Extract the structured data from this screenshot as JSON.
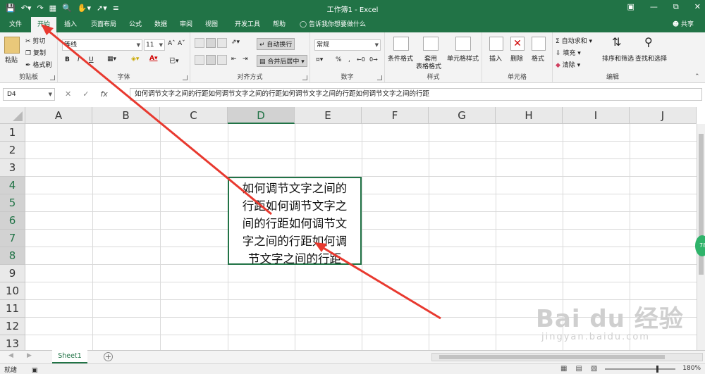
{
  "window": {
    "title": "工作簿1  -  Excel"
  },
  "tabs": [
    {
      "label": "文件"
    },
    {
      "label": "开始"
    },
    {
      "label": "插入"
    },
    {
      "label": "页面布局"
    },
    {
      "label": "公式"
    },
    {
      "label": "数据"
    },
    {
      "label": "审阅"
    },
    {
      "label": "视图"
    },
    {
      "label": "开发工具"
    },
    {
      "label": "帮助"
    }
  ],
  "tell_me": "告诉我你想要做什么",
  "share": "共享",
  "ribbon": {
    "clipboard": {
      "label": "剪贴板",
      "paste": "粘贴",
      "cut": "剪切",
      "copy": "复制",
      "format_painter": "格式刷"
    },
    "font": {
      "label": "字体",
      "font_name": "等线",
      "font_size": "11",
      "bold": "B",
      "italic": "I",
      "underline": "U"
    },
    "alignment": {
      "label": "对齐方式",
      "wrap": "自动换行",
      "merge": "合并后居中"
    },
    "number": {
      "label": "数字",
      "format": "常规",
      "percent": "%",
      "comma": ","
    },
    "styles": {
      "label": "样式",
      "conditional": "条件格式",
      "table1": "套用",
      "table2": "表格格式",
      "cell_styles": "单元格样式"
    },
    "cells": {
      "label": "单元格",
      "insert": "插入",
      "delete": "删除",
      "format": "格式"
    },
    "editing": {
      "label": "编辑",
      "autosum": "自动求和",
      "fill": "填充",
      "clear": "清除",
      "sort": "排序和筛选",
      "find": "查找和选择"
    }
  },
  "formula_bar": {
    "name_box": "D4",
    "fx": "fx",
    "content": "如何调节文字之间的行距如何调节文字之间的行距如何调节文字之间的行距如何调节文字之间的行距"
  },
  "columns": [
    "A",
    "B",
    "C",
    "D",
    "E",
    "F",
    "G",
    "H",
    "I",
    "J"
  ],
  "rows": [
    "1",
    "2",
    "3",
    "4",
    "5",
    "6",
    "7",
    "8",
    "9",
    "10",
    "11",
    "12",
    "13"
  ],
  "cell_text": "如何调节文字之间的\n行距如何调节文字之\n间的行距如何调节文\n字之间的行距如何调\n节文字之间的行距",
  "sheet_tab": "Sheet1",
  "status": {
    "ready": "就绪",
    "zoom": "180%"
  },
  "watermark": {
    "main": "Bai du 经验",
    "sub": "jingyan.baidu.com"
  },
  "side_badge": "78",
  "colors": {
    "excel_green": "#217346",
    "arrow_red": "#e8392f"
  }
}
